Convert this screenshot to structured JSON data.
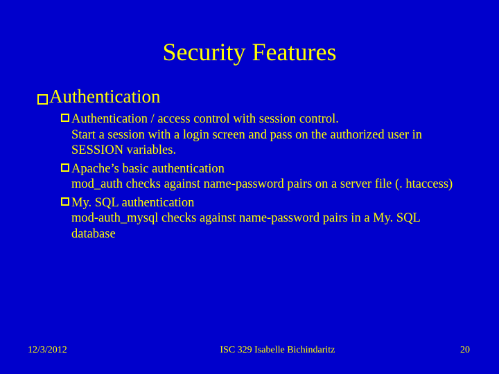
{
  "title": "Security Features",
  "heading": "Authentication",
  "items": [
    {
      "head": "Authentication / access control with session control.",
      "cont": "Start a session with a login screen and pass on the authorized user in SESSION variables."
    },
    {
      "head": "Apache’s basic authentication",
      "cont": "mod_auth checks against name-password pairs on a server file (. htaccess)"
    },
    {
      "head": "My. SQL authentication",
      "cont": "mod-auth_mysql checks against name-password pairs in a My. SQL database"
    }
  ],
  "footer": {
    "date": "12/3/2012",
    "mid": "ISC 329   Isabelle Bichindaritz",
    "page": "20"
  }
}
